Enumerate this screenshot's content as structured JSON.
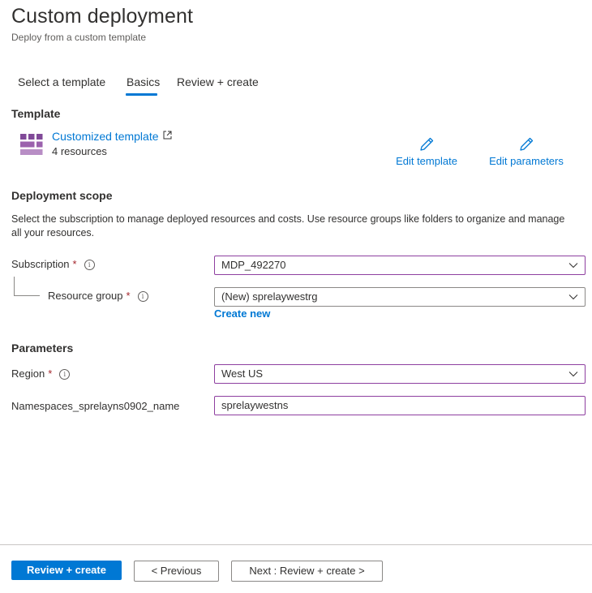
{
  "header": {
    "title": "Custom deployment",
    "subtitle": "Deploy from a custom template"
  },
  "tabs": [
    {
      "label": "Select a template",
      "active": false
    },
    {
      "label": "Basics",
      "active": true
    },
    {
      "label": "Review + create",
      "active": false
    }
  ],
  "template": {
    "section_title": "Template",
    "icon": "template-blocks-icon",
    "name": "Customized template",
    "external_link_icon": "external-link-icon",
    "resources": "4 resources",
    "edit_template_label": "Edit template",
    "edit_parameters_label": "Edit parameters",
    "edit_icon": "pencil-icon"
  },
  "scope": {
    "section_title": "Deployment scope",
    "description": "Select the subscription to manage deployed resources and costs. Use resource groups like folders to organize and manage all your resources.",
    "subscription": {
      "label": "Subscription",
      "required": "*",
      "value": "MDP_492270"
    },
    "resource_group": {
      "label": "Resource group",
      "required": "*",
      "value": "(New) sprelaywestrg",
      "create_new": "Create new"
    }
  },
  "parameters": {
    "section_title": "Parameters",
    "region": {
      "label": "Region",
      "required": "*",
      "value": "West US"
    },
    "namespace": {
      "label": "Namespaces_sprelayns0902_name",
      "value": "sprelaywestns"
    }
  },
  "footer": {
    "review_create": "Review + create",
    "previous": "< Previous",
    "next": "Next : Review + create >"
  },
  "colors": {
    "accent": "#0078d4",
    "focus_border": "#8e3fa0",
    "required": "#a4262c",
    "template_icon": "#804998"
  }
}
